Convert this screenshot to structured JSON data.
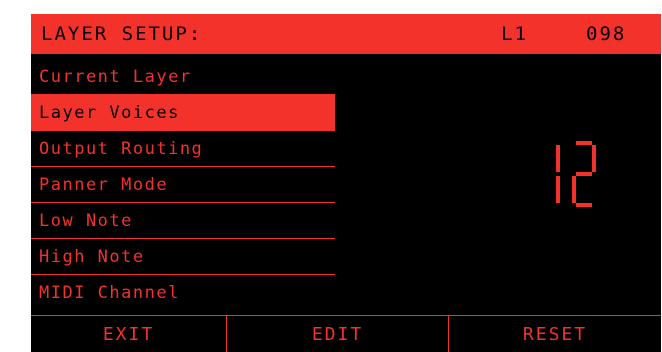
{
  "header": {
    "title": "LAYER SETUP:",
    "layer": "L1",
    "value": "098"
  },
  "menu": {
    "items": [
      {
        "label": "Current Layer",
        "selected": false
      },
      {
        "label": "Layer Voices",
        "selected": true
      },
      {
        "label": "Output Routing",
        "selected": false
      },
      {
        "label": "Panner Mode",
        "selected": false
      },
      {
        "label": "Low Note",
        "selected": false
      },
      {
        "label": "High Note",
        "selected": false
      },
      {
        "label": "MIDI Channel",
        "selected": false
      }
    ]
  },
  "display": {
    "value": "12"
  },
  "softkeys": {
    "exit": "EXIT",
    "edit": "EDIT",
    "reset": "RESET"
  },
  "colors": {
    "accent": "#f2322b",
    "background": "#000000"
  }
}
